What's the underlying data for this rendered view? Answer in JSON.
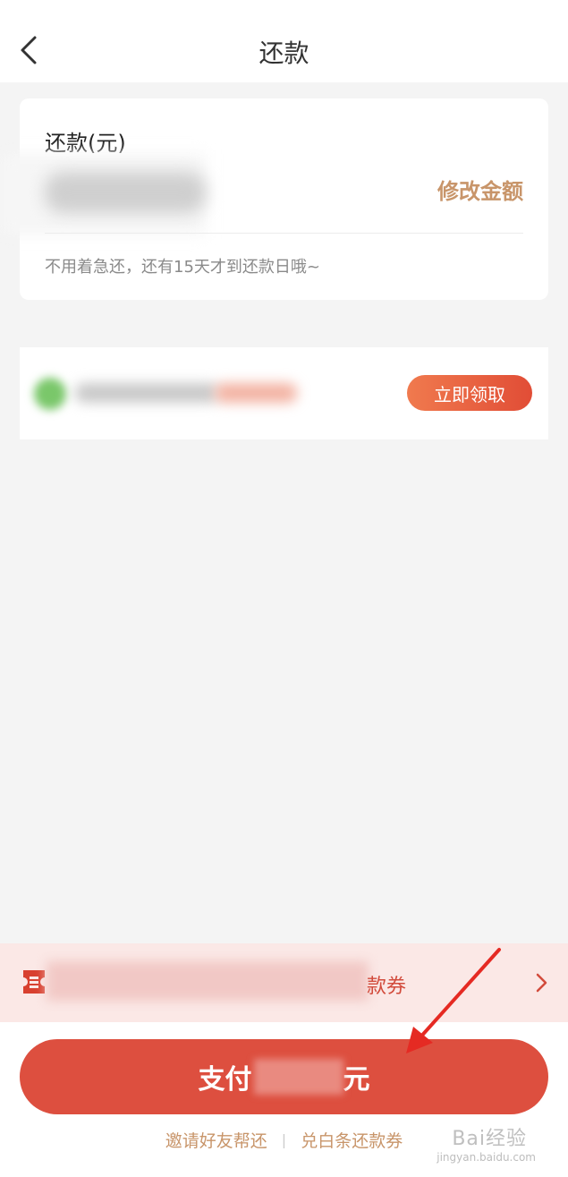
{
  "header": {
    "title": "还款",
    "back_icon": "chevron-left-icon"
  },
  "repay_card": {
    "label": "还款(元)",
    "modify_label": "修改金额",
    "hint": "不用着急还，还有15天才到还款日哦~"
  },
  "promo": {
    "claim_label": "立即领取"
  },
  "coupon_bar": {
    "icon": "ticket-icon",
    "text": "款券",
    "chevron_icon": "chevron-right-icon"
  },
  "bottom": {
    "pay_prefix": "支付",
    "pay_suffix": "元",
    "invite_label": "邀请好友帮还",
    "separator": "|",
    "redeem_label": "兑白条还款券"
  },
  "watermark": {
    "logo": "Bai经验",
    "url": "jingyan.baidu.com"
  },
  "colors": {
    "accent": "#dd4f3f",
    "link": "#c8956a",
    "claim_gradient_start": "#f07a4e",
    "claim_gradient_end": "#e14d36",
    "coupon_bg": "#fbe8e6"
  }
}
